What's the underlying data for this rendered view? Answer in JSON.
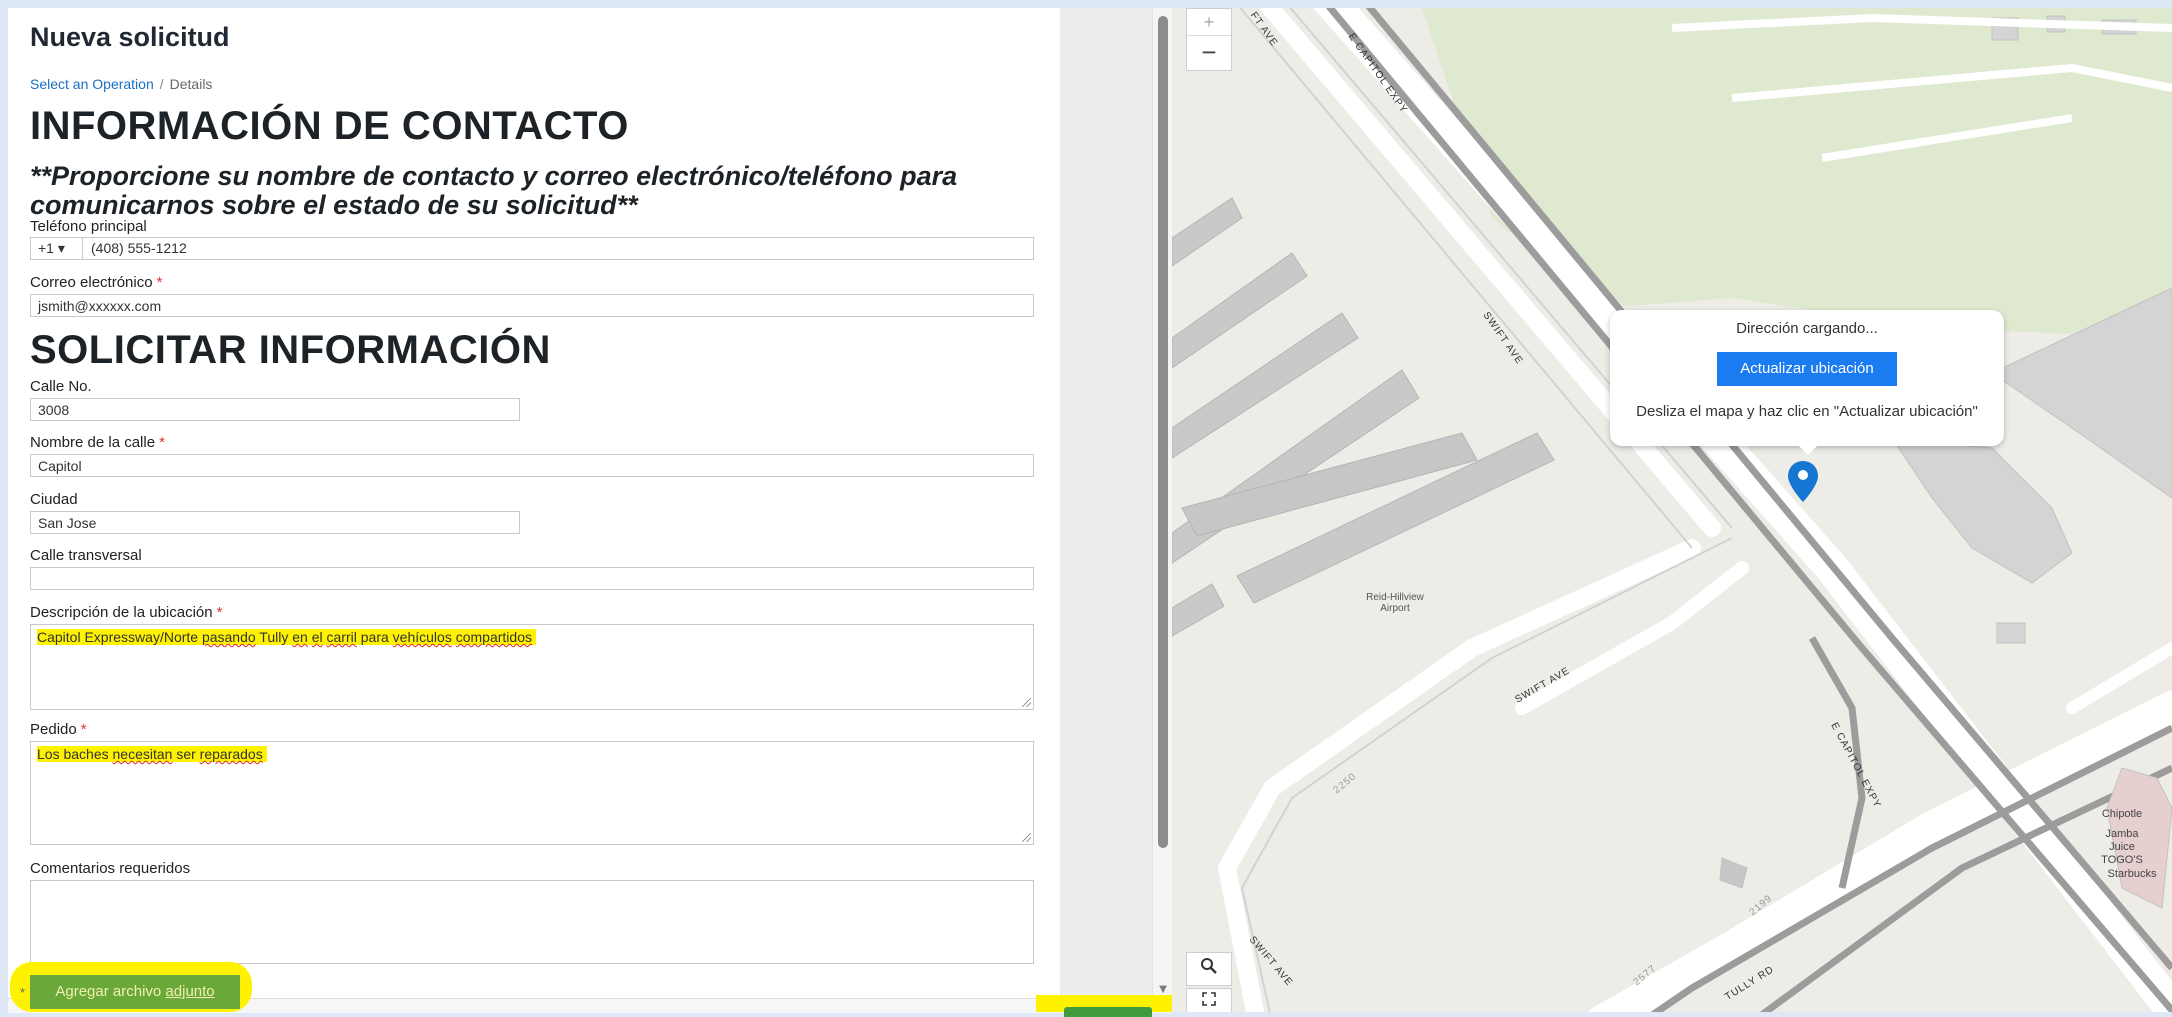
{
  "form": {
    "title": "Nueva solicitud",
    "breadcrumb": {
      "link": "Select an Operation",
      "separator": "/",
      "current": "Details"
    },
    "contact_heading": "INFORMACIÓN DE CONTACTO",
    "contact_subheading": "**Proporcione su nombre de contacto y correo electrónico/teléfono para comunicarnos sobre el estado de su solicitud**",
    "phone": {
      "label": "Teléfono principal",
      "country_code": "+1 ▾",
      "value": "(408) 555-1212"
    },
    "email": {
      "label": "Correo electrónico",
      "required": "*",
      "value": "jsmith@xxxxxx.com"
    },
    "request_heading": "SOLICITAR INFORMACIÓN",
    "street_no": {
      "label": "Calle No.",
      "value": "3008"
    },
    "street_name": {
      "label": "Nombre de la calle",
      "required": "*",
      "value": "Capitol"
    },
    "city": {
      "label": "Ciudad",
      "value": "San Jose"
    },
    "cross_street": {
      "label": "Calle transversal",
      "value": ""
    },
    "location_description": {
      "label": "Descripción de la ubicación",
      "required": "*",
      "parts": [
        "Capitol Expressway/Norte ",
        "pasando",
        " Tully ",
        "en",
        " ",
        "el",
        " ",
        "carril",
        " para ",
        "vehículos",
        " ",
        "compartidos"
      ]
    },
    "request": {
      "label": "Pedido",
      "required": "*",
      "parts": [
        "Los baches ",
        "necesitan",
        " ser ",
        "reparados"
      ]
    },
    "comments": {
      "label": "Comentarios requeridos",
      "value": ""
    },
    "attach": {
      "prefix": "Agregar archivo ",
      "underlined": "adjunto",
      "star": "*"
    }
  },
  "map": {
    "zoom_in": "+",
    "zoom_out": "−",
    "search_icon": "search-icon",
    "fullscreen_icon": "fullscreen-icon",
    "popup": {
      "status": "Dirección cargando...",
      "button": "Actualizar ubicación",
      "hint": "Desliza el mapa y haz clic en \"Actualizar ubicación\""
    },
    "airport_label": "Reid-Hillview\nAirport",
    "roads": {
      "swift_ave": "SWIFT AVE",
      "capitol_expy": "E CAPITOL EXPY",
      "tully_rd": "TULLY RD",
      "ft_ave": "FT AVE"
    },
    "numbers": [
      "2250",
      "2199",
      "2577"
    ],
    "poi": [
      "Chipotle",
      "Jamba\nJuice",
      "TOGO'S",
      "Starbucks"
    ],
    "colors": {
      "button": "#1a7cf0",
      "pin": "#1677d2",
      "highlight": "#fff200",
      "attach": "#6aa83a"
    }
  }
}
